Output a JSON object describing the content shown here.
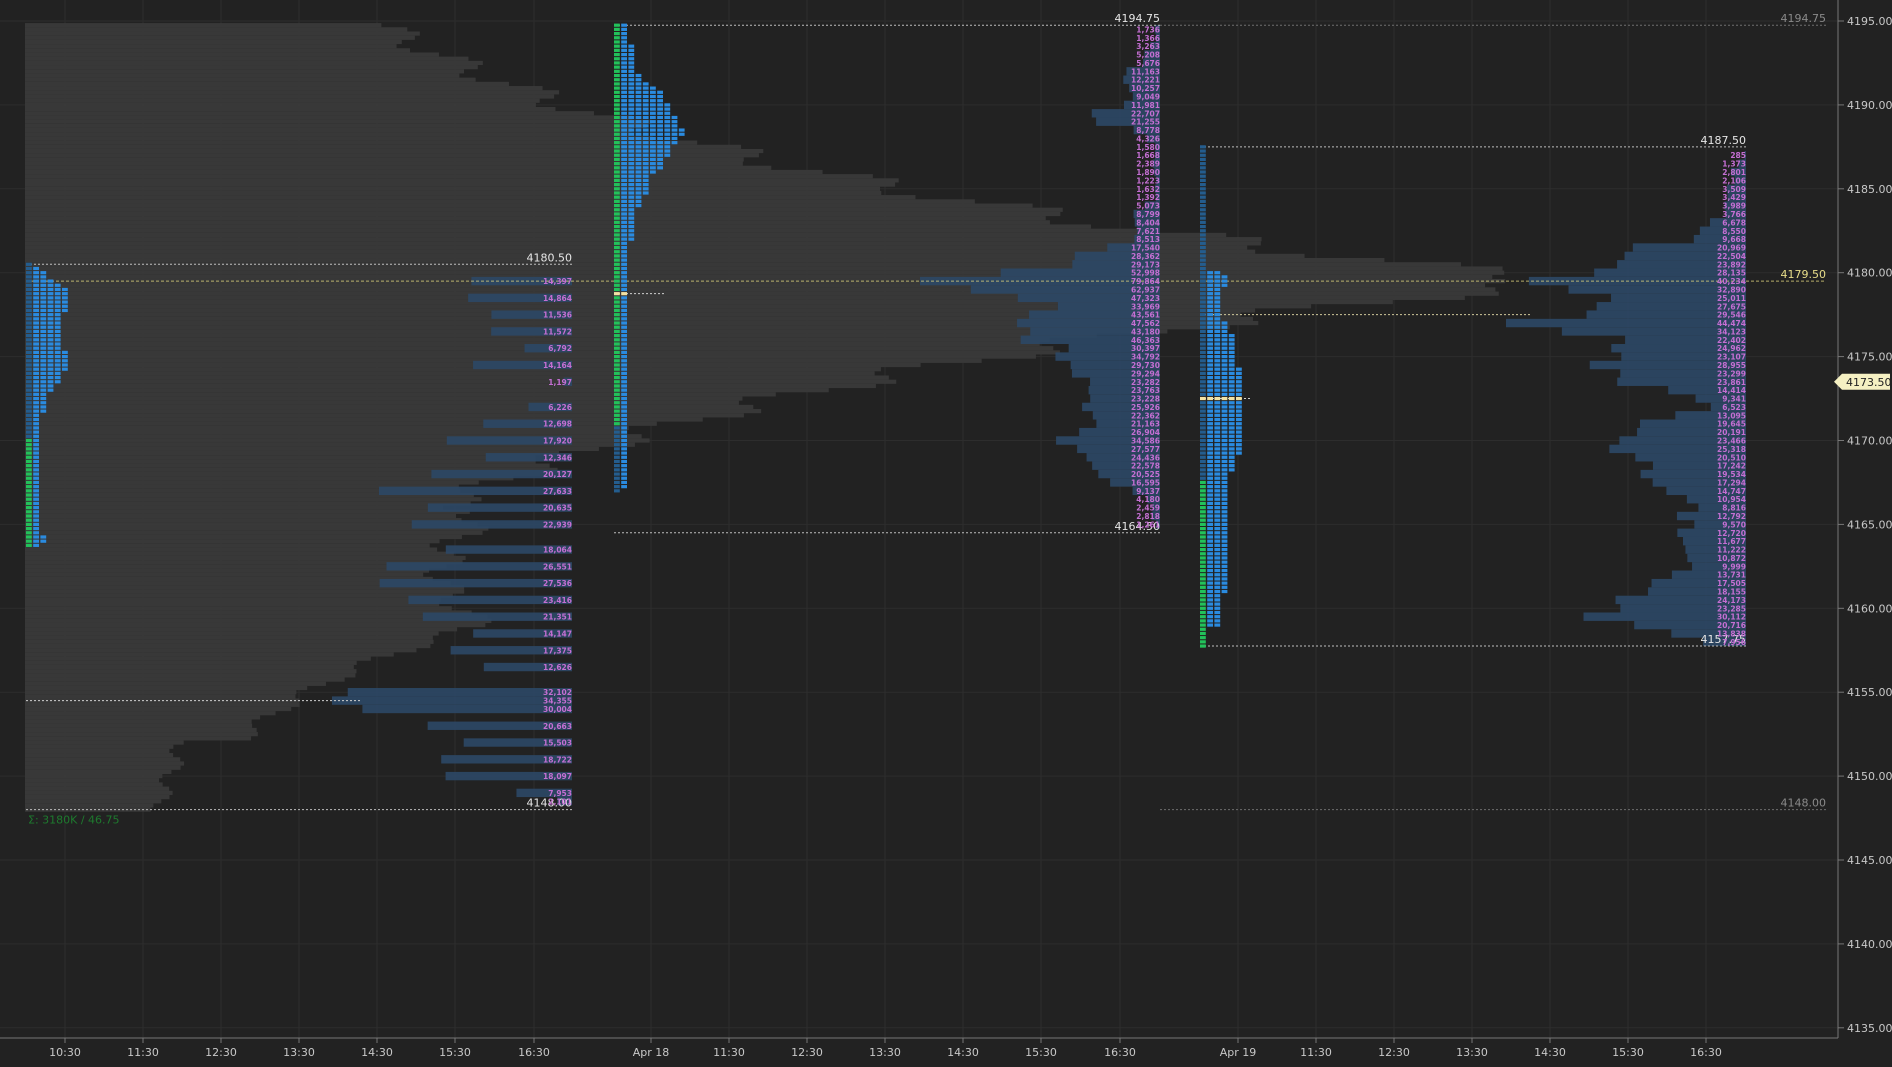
{
  "chart_data": {
    "type": "market-profile",
    "y_axis": {
      "min": 4133,
      "max": 4196,
      "ticks": [
        "4135.00",
        "4140.00",
        "4145.00",
        "4150.00",
        "4155.00",
        "4160.00",
        "4165.00",
        "4170.00",
        "4175.00",
        "4180.00",
        "4185.00",
        "4190.00",
        "4195.00"
      ],
      "current_price": "4173.50"
    },
    "x_axis": {
      "ticks": [
        "10:30",
        "11:30",
        "12:30",
        "13:30",
        "14:30",
        "15:30",
        "16:30",
        "Apr 18",
        "11:30",
        "12:30",
        "13:30",
        "14:30",
        "15:30",
        "16:30",
        "Apr 19",
        "11:30",
        "12:30",
        "13:30",
        "14:30",
        "15:30",
        "16:30"
      ]
    },
    "grid": true,
    "sessions": [
      {
        "high": 4180.5,
        "high_label": "4180.50",
        "low": 4148.0,
        "low_label": "4148.00",
        "poc": 4154.5,
        "tpo_counts": [
          1,
          2,
          3,
          3,
          4,
          5,
          6,
          6,
          6,
          6,
          6,
          6,
          5,
          5,
          5,
          5,
          5,
          5,
          5,
          5,
          5,
          6,
          6,
          6,
          6,
          6,
          5,
          5,
          5,
          4,
          4,
          3,
          3,
          3,
          3,
          3,
          2,
          2,
          2,
          2,
          2,
          2,
          2,
          2,
          2,
          2,
          2,
          2,
          2,
          2,
          2,
          2,
          2,
          2,
          2,
          2,
          2,
          2,
          2,
          2,
          2,
          2,
          2,
          2,
          2,
          3,
          3,
          2
        ],
        "green_start": 4160.0,
        "green_end": 4170.0,
        "volume_labels": [
          {
            "price": 4179.5,
            "text": "14,397"
          },
          {
            "price": 4178.5,
            "text": "14,864"
          },
          {
            "price": 4177.5,
            "text": "11,536"
          },
          {
            "price": 4176.5,
            "text": "11,572"
          },
          {
            "price": 4175.5,
            "text": "6,792"
          },
          {
            "price": 4174.5,
            "text": "14,164"
          },
          {
            "price": 4173.5,
            "text": "1,197"
          },
          {
            "price": 4172.0,
            "text": "6,226"
          },
          {
            "price": 4171.0,
            "text": "12,698"
          },
          {
            "price": 4170.0,
            "text": "17,920"
          },
          {
            "price": 4169.0,
            "text": "12,346"
          },
          {
            "price": 4168.0,
            "text": "20,127"
          },
          {
            "price": 4167.0,
            "text": "27,633"
          },
          {
            "price": 4166.0,
            "text": "20,635"
          },
          {
            "price": 4165.0,
            "text": "22,939"
          },
          {
            "price": 4163.5,
            "text": "18,064"
          },
          {
            "price": 4162.5,
            "text": "26,551"
          },
          {
            "price": 4161.5,
            "text": "27,536"
          },
          {
            "price": 4160.5,
            "text": "23,416"
          },
          {
            "price": 4159.5,
            "text": "21,351"
          },
          {
            "price": 4158.5,
            "text": "14,147"
          },
          {
            "price": 4157.5,
            "text": "17,375"
          },
          {
            "price": 4156.5,
            "text": "12,626"
          },
          {
            "price": 4155.0,
            "text": "32,102"
          },
          {
            "price": 4154.5,
            "text": "34,355"
          },
          {
            "price": 4154.0,
            "text": "30,004"
          },
          {
            "price": 4153.0,
            "text": "20,663"
          },
          {
            "price": 4152.0,
            "text": "15,503"
          },
          {
            "price": 4151.0,
            "text": "18,722"
          },
          {
            "price": 4150.0,
            "text": "18,097"
          },
          {
            "price": 4149.0,
            "text": "7,953"
          },
          {
            "price": 4148.5,
            "text": "2,101"
          }
        ],
        "footer_label": "Σ: 3180K / 46.75"
      },
      {
        "high": 4194.75,
        "high_label": "4194.75",
        "low": 4164.5,
        "low_label": "4164.50",
        "poc": 4178.75,
        "tpo_counts": [
          2,
          2,
          2,
          2,
          2,
          3,
          3,
          3,
          3,
          3,
          3,
          3,
          4,
          4,
          5,
          6,
          7,
          7,
          7,
          8,
          8,
          8,
          9,
          9,
          9,
          10,
          10,
          9,
          9,
          8,
          8,
          8,
          7,
          7,
          7,
          6,
          5,
          5,
          5,
          5,
          5,
          4,
          4,
          4,
          3,
          3,
          3,
          3,
          3,
          3,
          3,
          3,
          2,
          2,
          2,
          2,
          2,
          2,
          2,
          2,
          2,
          2,
          2,
          2,
          2,
          2,
          2,
          2,
          2,
          2,
          2,
          2,
          2,
          2,
          2,
          2,
          2,
          2,
          2,
          2,
          2,
          2,
          2,
          2,
          2,
          2,
          2,
          2,
          2,
          2,
          2,
          2,
          2,
          2,
          2,
          2,
          2,
          2,
          2,
          2,
          2,
          2,
          2,
          2,
          2,
          2,
          2,
          2,
          2,
          2,
          2,
          1
        ],
        "green_start": 4171.0,
        "green_end": 4194.75,
        "volume_labels": [
          {
            "price": 4194.5,
            "text": "1,736"
          },
          {
            "price": 4194.0,
            "text": "1,366"
          },
          {
            "price": 4193.5,
            "text": "3,263"
          },
          {
            "price": 4193.0,
            "text": "5,208"
          },
          {
            "price": 4192.5,
            "text": "5,676"
          },
          {
            "price": 4192.0,
            "text": "11,163"
          },
          {
            "price": 4191.5,
            "text": "12,221"
          },
          {
            "price": 4191.0,
            "text": "10,257"
          },
          {
            "price": 4190.5,
            "text": "9,049"
          },
          {
            "price": 4190.0,
            "text": "11,981"
          },
          {
            "price": 4189.5,
            "text": "22,707"
          },
          {
            "price": 4189.0,
            "text": "21,255"
          },
          {
            "price": 4188.5,
            "text": "8,778"
          },
          {
            "price": 4188.0,
            "text": "4,326"
          },
          {
            "price": 4187.5,
            "text": "1,580"
          },
          {
            "price": 4187.0,
            "text": "1,668"
          },
          {
            "price": 4186.5,
            "text": "2,389"
          },
          {
            "price": 4186.0,
            "text": "1,890"
          },
          {
            "price": 4185.5,
            "text": "1,223"
          },
          {
            "price": 4185.0,
            "text": "1,632"
          },
          {
            "price": 4184.5,
            "text": "1,392"
          },
          {
            "price": 4184.0,
            "text": "5,073"
          },
          {
            "price": 4183.5,
            "text": "8,799"
          },
          {
            "price": 4183.0,
            "text": "8,404"
          },
          {
            "price": 4182.5,
            "text": "7,621"
          },
          {
            "price": 4182.0,
            "text": "8,513"
          },
          {
            "price": 4181.5,
            "text": "17,540"
          },
          {
            "price": 4181.0,
            "text": "28,362"
          },
          {
            "price": 4180.5,
            "text": "29,173"
          },
          {
            "price": 4180.0,
            "text": "52,998"
          },
          {
            "price": 4179.5,
            "text": "79,864"
          },
          {
            "price": 4179.0,
            "text": "62,937"
          },
          {
            "price": 4178.5,
            "text": "47,323"
          },
          {
            "price": 4178.0,
            "text": "33,969"
          },
          {
            "price": 4177.5,
            "text": "43,561"
          },
          {
            "price": 4177.0,
            "text": "47,562"
          },
          {
            "price": 4176.5,
            "text": "43,180"
          },
          {
            "price": 4176.0,
            "text": "46,363"
          },
          {
            "price": 4175.5,
            "text": "30,397"
          },
          {
            "price": 4175.0,
            "text": "34,792"
          },
          {
            "price": 4174.5,
            "text": "29,730"
          },
          {
            "price": 4174.0,
            "text": "29,294"
          },
          {
            "price": 4173.5,
            "text": "23,282"
          },
          {
            "price": 4173.0,
            "text": "23,763"
          },
          {
            "price": 4172.5,
            "text": "23,228"
          },
          {
            "price": 4172.0,
            "text": "25,926"
          },
          {
            "price": 4171.5,
            "text": "22,362"
          },
          {
            "price": 4171.0,
            "text": "21,163"
          },
          {
            "price": 4170.5,
            "text": "26,904"
          },
          {
            "price": 4170.0,
            "text": "34,586"
          },
          {
            "price": 4169.5,
            "text": "27,577"
          },
          {
            "price": 4169.0,
            "text": "24,436"
          },
          {
            "price": 4168.5,
            "text": "22,578"
          },
          {
            "price": 4168.0,
            "text": "20,525"
          },
          {
            "price": 4167.5,
            "text": "16,595"
          },
          {
            "price": 4167.0,
            "text": "9,137"
          },
          {
            "price": 4166.5,
            "text": "4,180"
          },
          {
            "price": 4166.0,
            "text": "2,459"
          },
          {
            "price": 4165.5,
            "text": "2,818"
          },
          {
            "price": 4165.0,
            "text": "1,261"
          }
        ]
      },
      {
        "high": 4187.5,
        "high_label": "4187.50",
        "low": 4157.75,
        "low_label": "4157.75",
        "poc": 4172.5,
        "tpo_counts": [
          1,
          1,
          1,
          1,
          1,
          1,
          1,
          1,
          1,
          1,
          1,
          1,
          1,
          1,
          1,
          1,
          1,
          1,
          1,
          1,
          1,
          1,
          1,
          1,
          1,
          1,
          1,
          1,
          1,
          1,
          3,
          4,
          4,
          4,
          3,
          3,
          3,
          3,
          3,
          3,
          3,
          3,
          4,
          4,
          4,
          5,
          5,
          5,
          5,
          5,
          5,
          5,
          5,
          6,
          6,
          6,
          6,
          6,
          6,
          6,
          6,
          6,
          6,
          6,
          6,
          6,
          6,
          6,
          6,
          6,
          6,
          6,
          6,
          6,
          5,
          5,
          5,
          5,
          4,
          4,
          4,
          4,
          4,
          4,
          4,
          4,
          4,
          4,
          4,
          4,
          4,
          4,
          4,
          4,
          4,
          4,
          4,
          4,
          4,
          4,
          4,
          4,
          4,
          4,
          4,
          4,
          4,
          3,
          3,
          3,
          3,
          3,
          3,
          3,
          3,
          1,
          1,
          1,
          1,
          1
        ],
        "green_start": 4157.75,
        "green_end": 4167.5,
        "value_line": 4177.5,
        "volume_labels": [
          {
            "price": 4187.0,
            "text": "285"
          },
          {
            "price": 4186.5,
            "text": "1,373"
          },
          {
            "price": 4186.0,
            "text": "2,801"
          },
          {
            "price": 4185.5,
            "text": "2,106"
          },
          {
            "price": 4185.0,
            "text": "3,509"
          },
          {
            "price": 4184.5,
            "text": "3,429"
          },
          {
            "price": 4184.0,
            "text": "3,989"
          },
          {
            "price": 4183.5,
            "text": "3,766"
          },
          {
            "price": 4183.0,
            "text": "6,678"
          },
          {
            "price": 4182.5,
            "text": "8,550"
          },
          {
            "price": 4182.0,
            "text": "9,668"
          },
          {
            "price": 4181.5,
            "text": "20,969"
          },
          {
            "price": 4181.0,
            "text": "22,504"
          },
          {
            "price": 4180.5,
            "text": "23,892"
          },
          {
            "price": 4180.0,
            "text": "28,135"
          },
          {
            "price": 4179.5,
            "text": "40,234"
          },
          {
            "price": 4179.0,
            "text": "32,890"
          },
          {
            "price": 4178.5,
            "text": "25,011"
          },
          {
            "price": 4178.0,
            "text": "27,675"
          },
          {
            "price": 4177.5,
            "text": "29,546"
          },
          {
            "price": 4177.0,
            "text": "44,474"
          },
          {
            "price": 4176.5,
            "text": "34,123"
          },
          {
            "price": 4176.0,
            "text": "22,402"
          },
          {
            "price": 4175.5,
            "text": "24,962"
          },
          {
            "price": 4175.0,
            "text": "23,107"
          },
          {
            "price": 4174.5,
            "text": "28,955"
          },
          {
            "price": 4174.0,
            "text": "23,299"
          },
          {
            "price": 4173.5,
            "text": "23,861"
          },
          {
            "price": 4173.0,
            "text": "14,414"
          },
          {
            "price": 4172.5,
            "text": "9,341"
          },
          {
            "price": 4172.0,
            "text": "6,523"
          },
          {
            "price": 4171.5,
            "text": "13,095"
          },
          {
            "price": 4171.0,
            "text": "19,645"
          },
          {
            "price": 4170.5,
            "text": "20,191"
          },
          {
            "price": 4170.0,
            "text": "23,466"
          },
          {
            "price": 4169.5,
            "text": "25,318"
          },
          {
            "price": 4169.0,
            "text": "20,510"
          },
          {
            "price": 4168.5,
            "text": "17,242"
          },
          {
            "price": 4168.0,
            "text": "19,534"
          },
          {
            "price": 4167.5,
            "text": "17,294"
          },
          {
            "price": 4167.0,
            "text": "14,747"
          },
          {
            "price": 4166.5,
            "text": "10,954"
          },
          {
            "price": 4166.0,
            "text": "8,816"
          },
          {
            "price": 4165.5,
            "text": "12,792"
          },
          {
            "price": 4165.0,
            "text": "9,570"
          },
          {
            "price": 4164.5,
            "text": "12,720"
          },
          {
            "price": 4164.0,
            "text": "11,677"
          },
          {
            "price": 4163.5,
            "text": "11,222"
          },
          {
            "price": 4163.0,
            "text": "10,872"
          },
          {
            "price": 4162.5,
            "text": "9,999"
          },
          {
            "price": 4162.0,
            "text": "13,731"
          },
          {
            "price": 4161.5,
            "text": "17,505"
          },
          {
            "price": 4161.0,
            "text": "18,155"
          },
          {
            "price": 4160.5,
            "text": "24,173"
          },
          {
            "price": 4160.0,
            "text": "23,285"
          },
          {
            "price": 4159.5,
            "text": "30,112"
          },
          {
            "price": 4159.0,
            "text": "20,716"
          },
          {
            "price": 4158.5,
            "text": "13,838"
          },
          {
            "price": 4158.0,
            "text": "7,956"
          }
        ]
      }
    ],
    "composite_profile": {
      "high": 4194.75,
      "high_label": "4194.75",
      "low": 4148.0,
      "low_label": "4148.00",
      "poc": 4179.5,
      "poc_label": "4179.50"
    }
  },
  "colors": {
    "background": "#222222",
    "grid": "#2d2d2d",
    "tpo_blue": "#2a8be0",
    "tpo_green": "#22c25a",
    "tpo_dark": "#245d8e",
    "poc": "#f2e2a4",
    "volume_label": "#c56fd3",
    "composite_gray": "#3c3c3c",
    "volume_profile_blue": "#2c4866",
    "axis_text": "#c8c8c8",
    "price_marker": "#f5f0c2"
  }
}
